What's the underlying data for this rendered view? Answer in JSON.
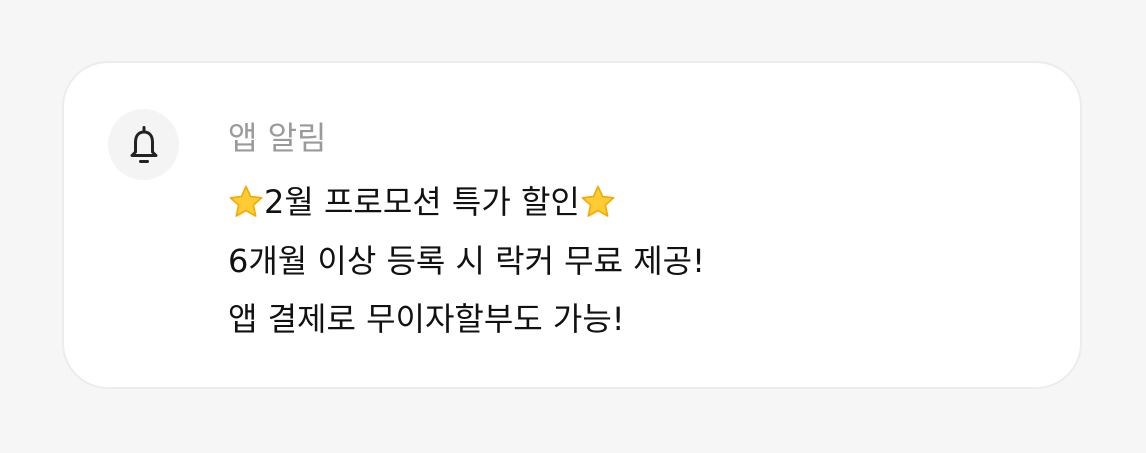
{
  "notification": {
    "app_label": "앱 알림",
    "icon": "bell-icon",
    "lines": [
      {
        "leading_icon": "star-icon",
        "text": "2월 프로모션 특가 할인",
        "trailing_icon": "star-icon"
      },
      {
        "text": "6개월 이상 등록 시 락커 무료 제공!"
      },
      {
        "text": "앱 결제로 무이자할부도 가능!"
      }
    ]
  },
  "colors": {
    "page_background": "#f6f6f6",
    "card_background": "#ffffff",
    "card_border": "#ececec",
    "icon_circle": "#f4f4f4",
    "label_text": "#9a9a9a",
    "body_text": "#111111",
    "star_fill": "#ffcc33",
    "star_stroke": "#f2a900"
  }
}
